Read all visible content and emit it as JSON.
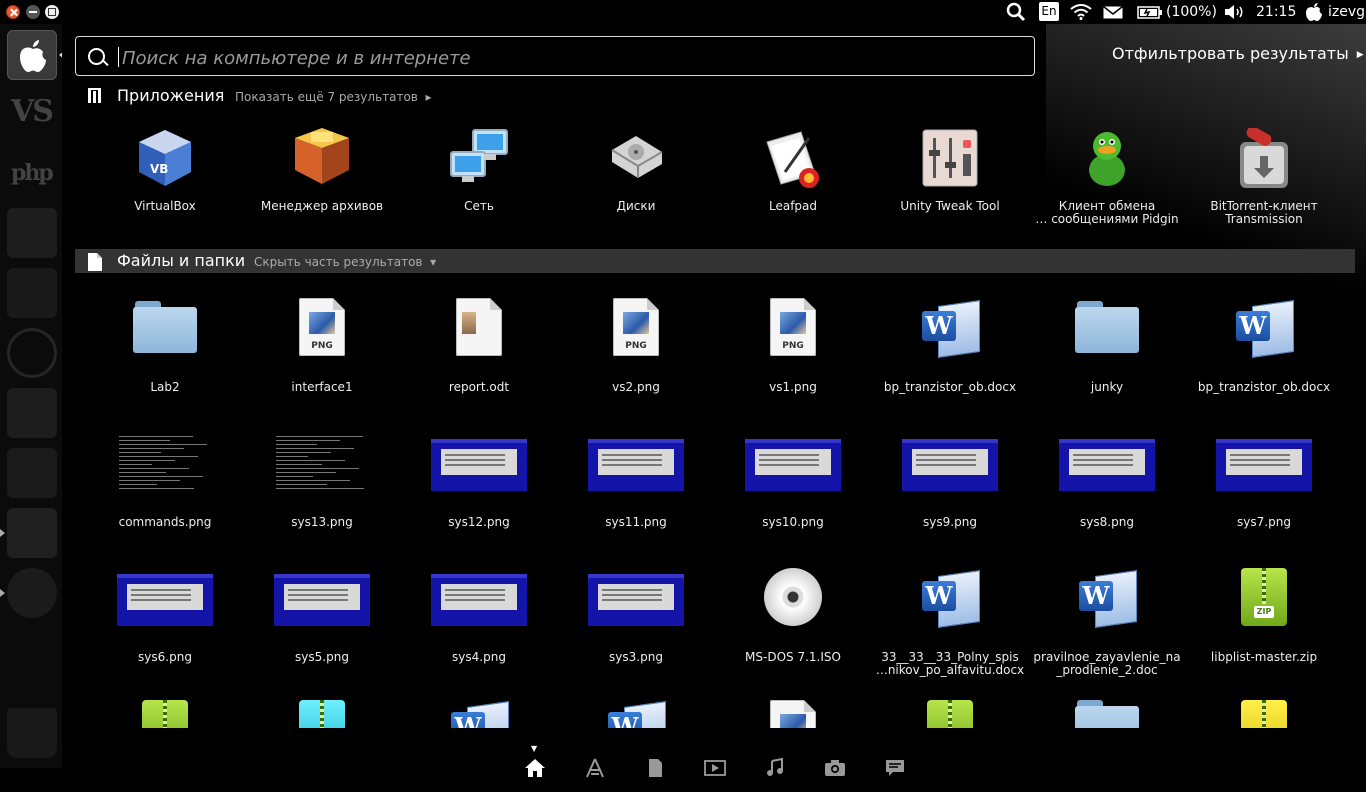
{
  "panel": {
    "keyboard_layout": "En",
    "battery": "(100%)",
    "time": "21:15",
    "user": "izevg"
  },
  "search": {
    "placeholder": "Поиск на компьютере и в интернете",
    "filter_label": "Отфильтровать результаты"
  },
  "apps_section": {
    "title": "Приложения",
    "more": "Показать ещё 7 результатов",
    "items": [
      {
        "label": "VirtualBox",
        "icon": "virtualbox-icon"
      },
      {
        "label": "Менеджер архивов",
        "icon": "archive-manager-icon"
      },
      {
        "label": "Сеть",
        "icon": "network-icon"
      },
      {
        "label": "Диски",
        "icon": "disks-icon"
      },
      {
        "label": "Leafpad",
        "icon": "leafpad-icon"
      },
      {
        "label": "Unity Tweak Tool",
        "icon": "unity-tweak-tool-icon"
      },
      {
        "label": "Клиент обмена\n… сообщениями Pidgin",
        "icon": "pidgin-icon"
      },
      {
        "label": "BitTorrent-клиент\nTransmission",
        "icon": "transmission-icon"
      }
    ]
  },
  "files_section": {
    "title": "Файлы и папки",
    "more": "Скрыть часть результатов",
    "items": [
      {
        "label": "Lab2",
        "kind": "folder"
      },
      {
        "label": "interface1",
        "kind": "png"
      },
      {
        "label": "report.odt",
        "kind": "odt"
      },
      {
        "label": "vs2.png",
        "kind": "png"
      },
      {
        "label": "vs1.png",
        "kind": "png"
      },
      {
        "label": "bp_tranzistor_ob.docx",
        "kind": "word"
      },
      {
        "label": "junky",
        "kind": "folder"
      },
      {
        "label": "bp_tranzistor_ob.docx",
        "kind": "word"
      },
      {
        "label": "commands.png",
        "kind": "terminal-shot"
      },
      {
        "label": "sys13.png",
        "kind": "terminal-shot"
      },
      {
        "label": "sys12.png",
        "kind": "dos-shot"
      },
      {
        "label": "sys11.png",
        "kind": "dos-shot"
      },
      {
        "label": "sys10.png",
        "kind": "dos-shot"
      },
      {
        "label": "sys9.png",
        "kind": "dos-shot"
      },
      {
        "label": "sys8.png",
        "kind": "dos-shot"
      },
      {
        "label": "sys7.png",
        "kind": "dos-shot"
      },
      {
        "label": "sys6.png",
        "kind": "dos-shot"
      },
      {
        "label": "sys5.png",
        "kind": "dos-shot"
      },
      {
        "label": "sys4.png",
        "kind": "dos-shot"
      },
      {
        "label": "sys3.png",
        "kind": "dos-shot"
      },
      {
        "label": "MS-DOS 7.1.ISO",
        "kind": "cd"
      },
      {
        "label": "33__33__33_Polny_spis\n…nikov_po_alfavitu.docx",
        "kind": "word"
      },
      {
        "label": "pravilnoe_zayavlenie_na\n_prodlenie_2.doc",
        "kind": "word"
      },
      {
        "label": "libplist-master.zip",
        "kind": "zip"
      }
    ],
    "partial_row": [
      "zip",
      "archive-cyan",
      "word",
      "word",
      "png",
      "zip",
      "folder",
      "archive-yellow"
    ]
  },
  "lenses": [
    "home-lens-icon",
    "applications-lens-icon",
    "files-lens-icon",
    "video-lens-icon",
    "music-lens-icon",
    "photo-lens-icon",
    "social-lens-icon"
  ],
  "launcher": [
    "apple-dash-icon",
    "visual-studio-icon",
    "php-storm-icon",
    "app-icon",
    "finder-icon",
    "app-store-icon",
    "system-settings-icon",
    "drive-icon",
    "text-editor-icon",
    "chrome-icon",
    "trash-icon"
  ]
}
